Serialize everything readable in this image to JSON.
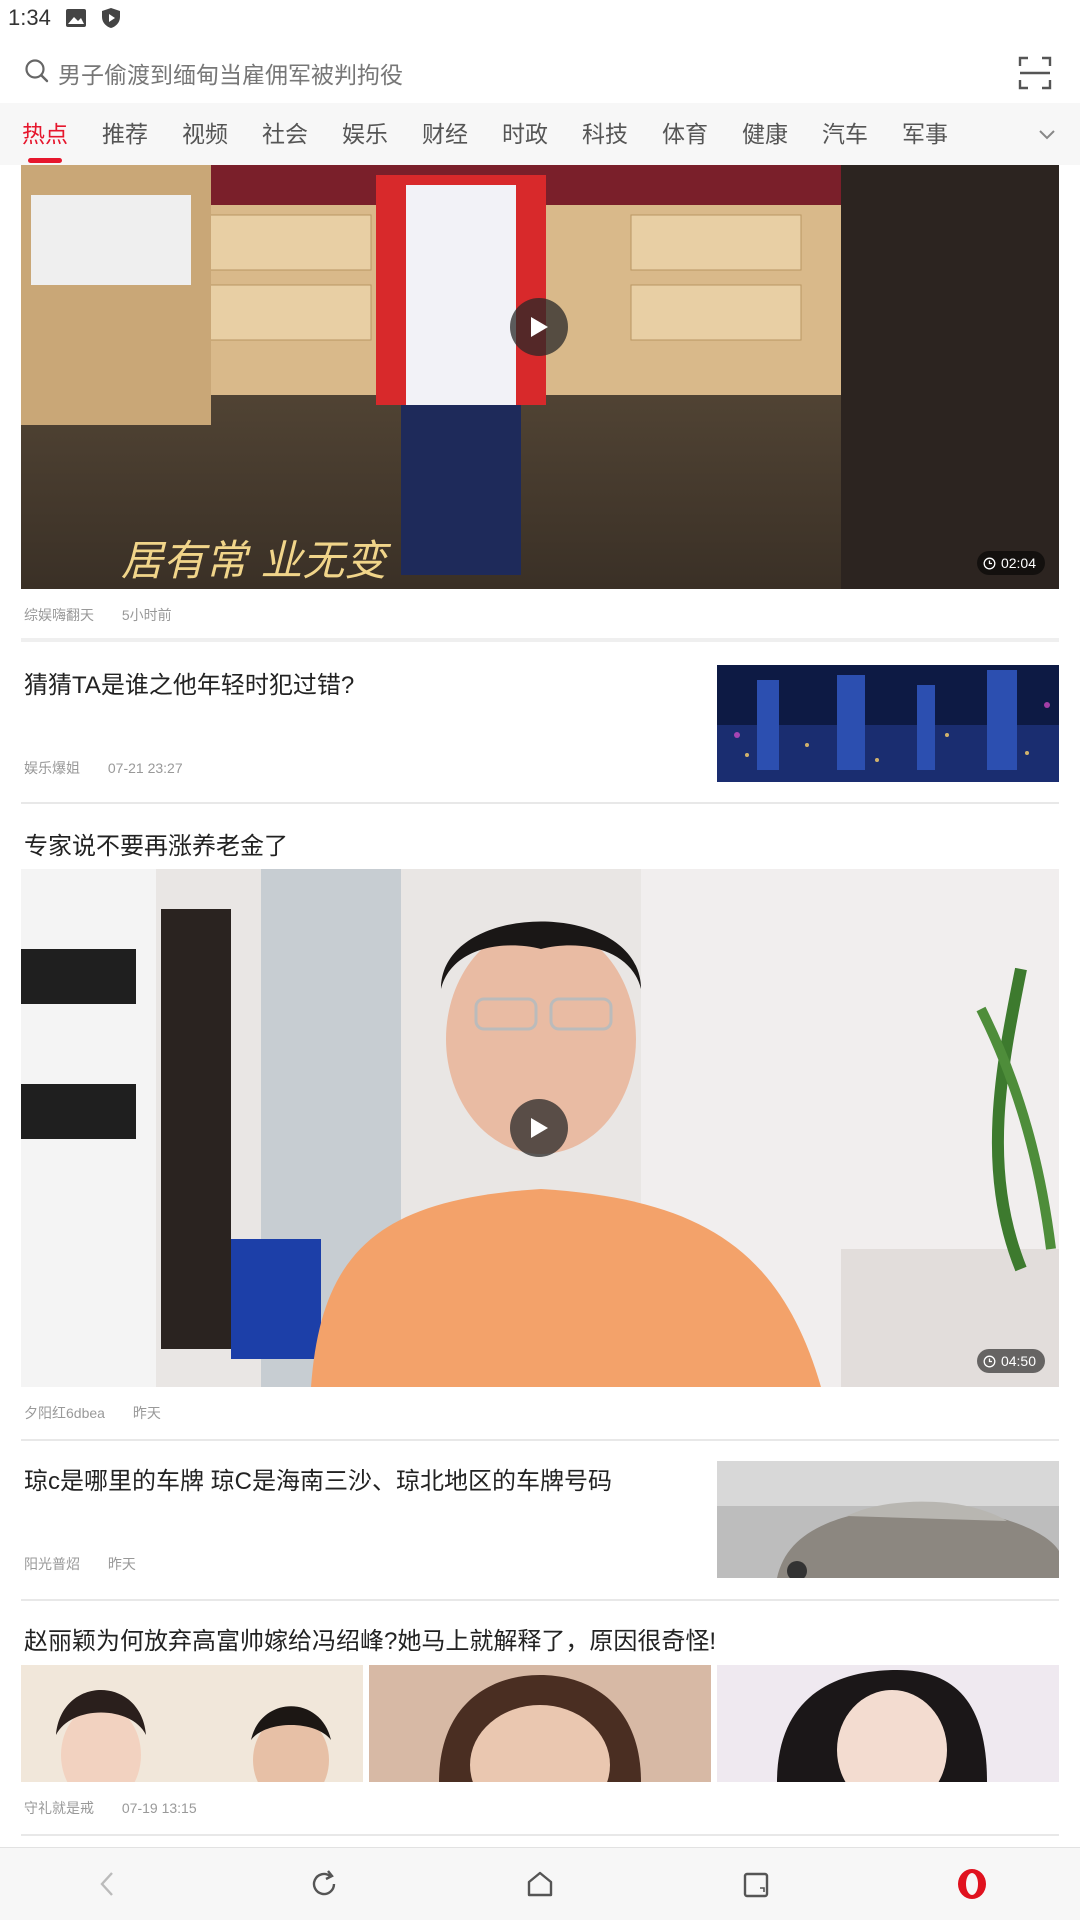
{
  "status_bar": {
    "time": "1:34"
  },
  "search": {
    "query": "男子偷渡到缅甸当雇佣军被判拘役"
  },
  "tabs": [
    "热点",
    "推荐",
    "视频",
    "社会",
    "娱乐",
    "财经",
    "时政",
    "科技",
    "体育",
    "健康",
    "汽车",
    "军事"
  ],
  "active_tab": "热点",
  "feed": [
    {
      "type": "video",
      "source": "综娱嗨翻天",
      "time": "5小时前",
      "duration": "02:04",
      "caption": "居有常 业无变"
    },
    {
      "type": "article",
      "title": "猜猜TA是谁之他年轻时犯过错?",
      "source": "娱乐爆姐",
      "time": "07-21 23:27"
    },
    {
      "type": "video",
      "title": "专家说不要再涨养老金了",
      "source": "夕阳红6dbea",
      "time": "昨天",
      "duration": "04:50"
    },
    {
      "type": "article",
      "title": "琼c是哪里的车牌 琼C是海南三沙、琼北地区的车牌号码",
      "source": "阳光普炤",
      "time": "昨天"
    },
    {
      "type": "gallery",
      "title": "赵丽颖为何放弃高富帅嫁给冯绍峰?她马上就解释了，原因很奇怪!",
      "source": "守礼就是戒",
      "time": "07-19 13:15"
    }
  ],
  "colors": {
    "accent": "#e6172d",
    "browser_brand": "#e0121f"
  },
  "icons": [
    "image-icon",
    "shield-icon",
    "search-icon",
    "scan-icon",
    "chevron-down-icon",
    "play-icon",
    "clock-icon",
    "back-icon",
    "refresh-icon",
    "home-icon",
    "tabs-icon",
    "opera-icon"
  ]
}
